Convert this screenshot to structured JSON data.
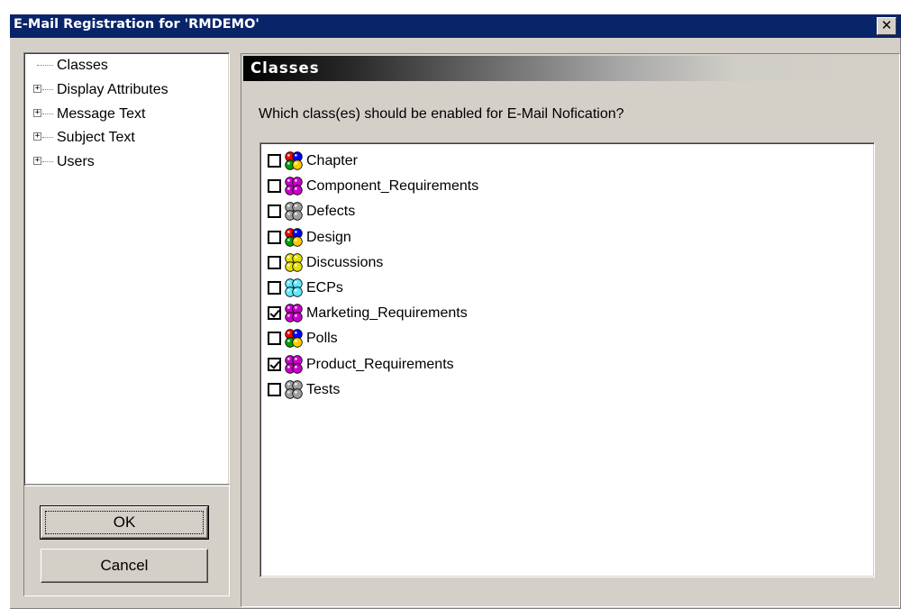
{
  "window": {
    "title": "E-Mail Registration for 'RMDEMO'",
    "close_label": "✕"
  },
  "tree": {
    "items": [
      {
        "label": "Classes",
        "expandable": false
      },
      {
        "label": "Display Attributes",
        "expandable": true
      },
      {
        "label": "Message Text",
        "expandable": true
      },
      {
        "label": "Subject Text",
        "expandable": true
      },
      {
        "label": "Users",
        "expandable": true
      }
    ],
    "expander_glyph": "+"
  },
  "buttons": {
    "ok_label": "OK",
    "cancel_label": "Cancel"
  },
  "section": {
    "header": "Classes",
    "prompt": "Which class(es) should be enabled for E-Mail Nofication?"
  },
  "classes": [
    {
      "label": "Chapter",
      "checked": false,
      "icon": "multicolor-spheres-icon",
      "colors": [
        "#ff0000",
        "#0000ff",
        "#00a000",
        "#ffcc00"
      ]
    },
    {
      "label": "Component_Requirements",
      "checked": false,
      "icon": "magenta-spheres-icon",
      "colors": [
        "#cc00cc",
        "#cc00cc",
        "#cc00cc",
        "#cc00cc"
      ]
    },
    {
      "label": "Defects",
      "checked": false,
      "icon": "gray-spheres-icon",
      "colors": [
        "#a0a0a0",
        "#a0a0a0",
        "#a0a0a0",
        "#a0a0a0"
      ]
    },
    {
      "label": "Design",
      "checked": false,
      "icon": "multicolor-spheres-icon",
      "colors": [
        "#ff0000",
        "#0000ff",
        "#00a000",
        "#ffcc00"
      ]
    },
    {
      "label": "Discussions",
      "checked": false,
      "icon": "yellow-spheres-icon",
      "colors": [
        "#e8e000",
        "#e8e000",
        "#e8e000",
        "#e8e000"
      ]
    },
    {
      "label": "ECPs",
      "checked": false,
      "icon": "cyan-spheres-icon",
      "colors": [
        "#60e8ff",
        "#60e8ff",
        "#60e8ff",
        "#60e8ff"
      ]
    },
    {
      "label": "Marketing_Requirements",
      "checked": true,
      "icon": "magenta-spheres-icon",
      "colors": [
        "#cc00cc",
        "#cc00cc",
        "#cc00cc",
        "#cc00cc"
      ]
    },
    {
      "label": "Polls",
      "checked": false,
      "icon": "multicolor-spheres-icon",
      "colors": [
        "#ff0000",
        "#0000ff",
        "#00a000",
        "#ffcc00"
      ]
    },
    {
      "label": "Product_Requirements",
      "checked": true,
      "icon": "magenta-spheres-icon",
      "colors": [
        "#cc00cc",
        "#cc00cc",
        "#cc00cc",
        "#cc00cc"
      ]
    },
    {
      "label": "Tests",
      "checked": false,
      "icon": "gray-spheres-icon",
      "colors": [
        "#a0a0a0",
        "#a0a0a0",
        "#a0a0a0",
        "#a0a0a0"
      ]
    }
  ]
}
